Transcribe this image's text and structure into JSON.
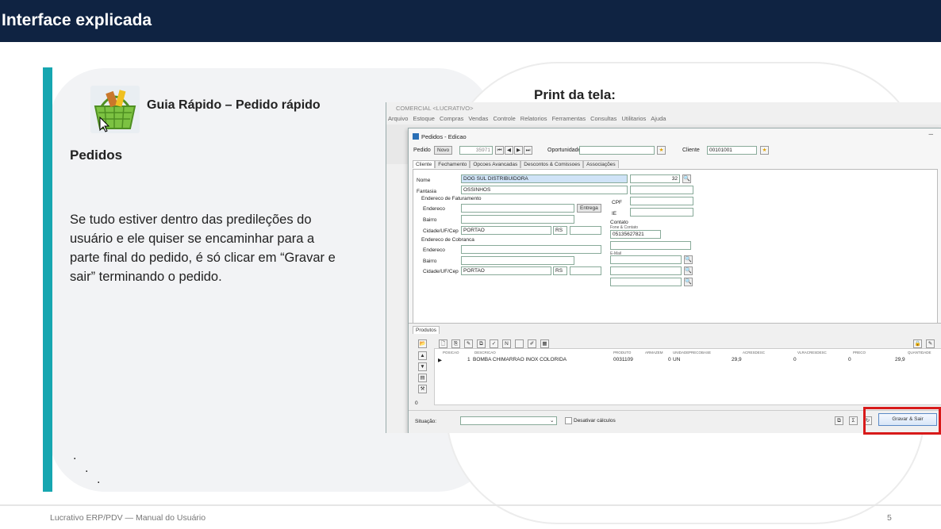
{
  "header": {
    "title": "Interface explicada"
  },
  "guide": {
    "title": "Guia Rápido – Pedido rápido"
  },
  "section": {
    "title": "Pedidos"
  },
  "body_text": "Se tudo estiver dentro das predileções do usuário e ele quiser se encaminhar para a parte final do pedido, é só clicar em “Gravar e sair” terminando o pedido.",
  "dots": [
    ".",
    ".",
    "."
  ],
  "print_label": "Print da tela:",
  "footer": {
    "text": "Lucrativo ERP/PDV — Manual do Usuário",
    "page": "5"
  },
  "colors": {
    "topbar": "#0f2342",
    "accent": "#16a6b0",
    "highlight": "#d81a1a"
  },
  "screenshot": {
    "app_title": "COMERCIAL <LUCRATIVO>",
    "menu": [
      "Arquivo",
      "Estoque",
      "Compras",
      "Vendas",
      "Controle",
      "Relatorios",
      "Ferramentas",
      "Consultas",
      "Utilitarios",
      "Ajuda"
    ],
    "window_title": "Pedidos - Edicao",
    "pedido_label": "Pedido",
    "novo_label": "Novo",
    "pedido_number": "35971",
    "oportunidade_label": "Oportunidade:",
    "cliente_label": "Cliente",
    "cliente_code": "00101001",
    "tabs": [
      "Cliente",
      "Fechamento",
      "Opcoes Avancadas",
      "Descontos & Comissoes",
      "Associações"
    ],
    "nome_label": "Nome",
    "nome_value": "DOG SUL DISTRIBUIDORA",
    "nome_code": "32",
    "fantasia_label": "Fantasia",
    "fantasia_value": "OSSINHOS",
    "faturamento_label": "Endereco de Faturamento",
    "endereco_label": "Endereco",
    "entrega_button": "Entrega",
    "bairro_label": "Bairro",
    "cidade_label": "Cidade/UF/Cep",
    "cidade_value": "PORTAO",
    "uf_value": "RS",
    "cobranca_label": "Endereco de Cobranca",
    "cpf_label": "CPF",
    "ie_label": "IE",
    "contato_label": "Contato",
    "fone_label": "Fone & Contato",
    "fone_value": "05135627821",
    "email_label": "E-Mail",
    "produtos_tab": "Produtos",
    "grid_headers": [
      "POSICAO",
      "DESCRICAO",
      "PRODUTO",
      "ARMAZEM",
      "UNIDADE",
      "PRECOBASE",
      "ACRESDESC",
      "VLRACRESDESC",
      "PRECO",
      "QUANTIDADE"
    ],
    "grid_row": {
      "pos": "1",
      "desc": "BOMBA CHIMARRAO INOX COLORIDA",
      "produto": "0031109",
      "armazem": "0",
      "unidade": "UN",
      "precobase": "29,9",
      "acres": "0",
      "vlracres": "0",
      "preco": "29,9"
    },
    "grid_count": "0",
    "situacao_label": "Situação:",
    "desativar_label": "Desativar cálculos",
    "gravar_button": "Gravar & Sair"
  }
}
